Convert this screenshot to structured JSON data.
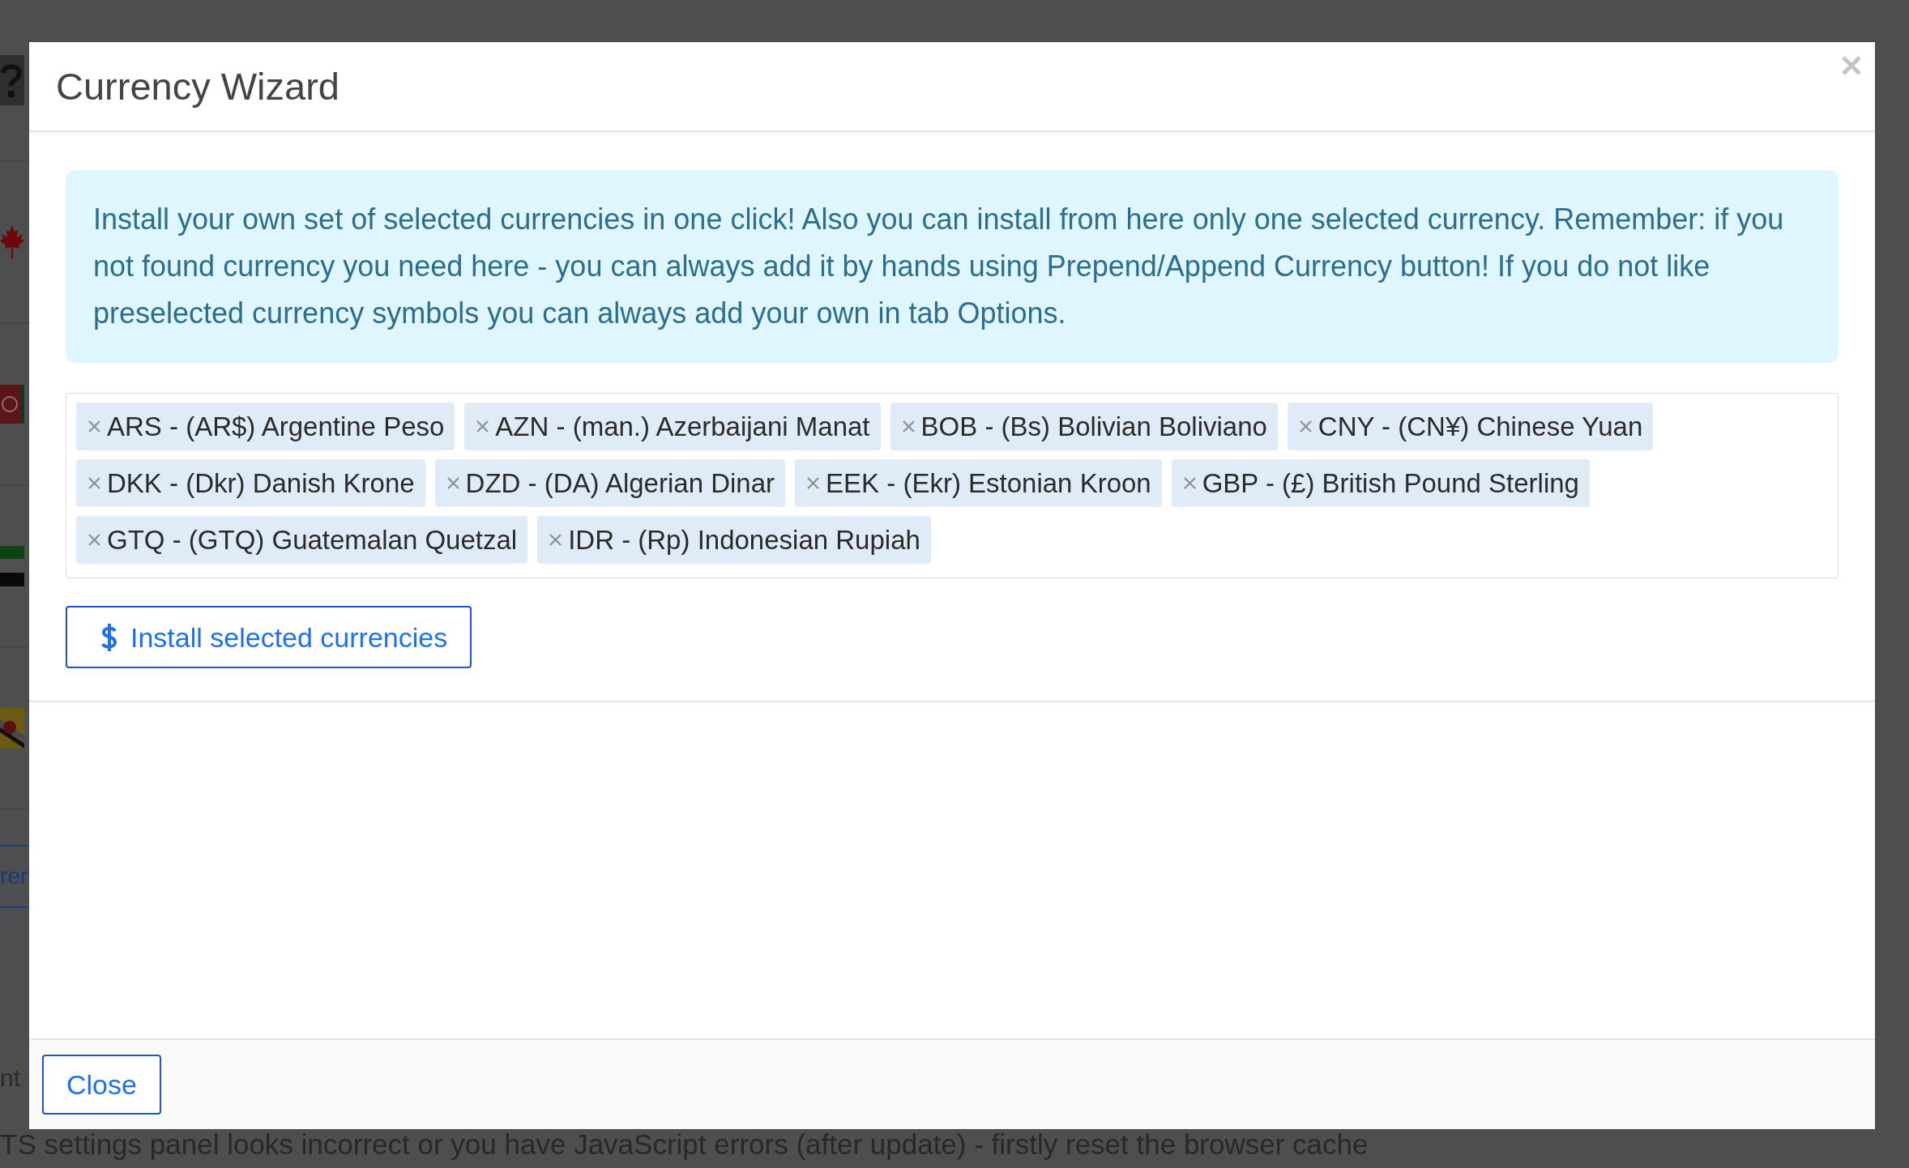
{
  "background_page": {
    "side_items": [
      {
        "kind": "unknown_image"
      },
      {
        "kind": "maple_leaf_flag"
      },
      {
        "kind": "emblem_flag"
      },
      {
        "kind": "striped_flag"
      },
      {
        "kind": "yellow_emblem_flag"
      },
      {
        "kind": "link",
        "text": "rer"
      },
      {
        "kind": "text",
        "text": "nt"
      }
    ],
    "notice": "TS settings panel looks incorrect or you have JavaScript errors (after update) - firstly reset the browser cache"
  },
  "dialog": {
    "title": "Currency Wizard",
    "info": "Install your own set of selected currencies in one click! Also you can install from here only one selected currency. Remember: if you not found currency you need here - you can always add it by hands using Prepend/Append Currency button! If you do not like preselected currency symbols you can always add your own in tab Options.",
    "selected_currencies": [
      "ARS - (AR$) Argentine Peso",
      "AZN - (man.) Azerbaijani Manat",
      "BOB - (Bs) Bolivian Boliviano",
      "CNY - (CN¥) Chinese Yuan",
      "DKK - (Dkr) Danish Krone",
      "DZD - (DA) Algerian Dinar",
      "EEK - (Ekr) Estonian Kroon",
      "GBP - (£) British Pound Sterling",
      "GTQ - (GTQ) Guatemalan Quetzal",
      "IDR - (Rp) Indonesian Rupiah"
    ],
    "install_button": "Install selected currencies",
    "close_button": "Close"
  }
}
